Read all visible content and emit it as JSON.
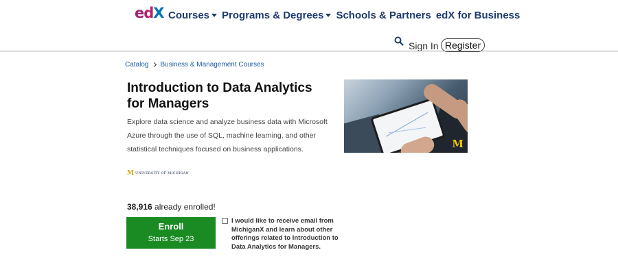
{
  "header": {
    "logo": {
      "e": "e",
      "d": "d",
      "x": "X"
    },
    "nav": [
      {
        "label": "Courses",
        "has_dropdown": true
      },
      {
        "label": "Programs & Degrees",
        "has_dropdown": true
      },
      {
        "label": "Schools & Partners",
        "has_dropdown": false
      },
      {
        "label": "edX for Business",
        "has_dropdown": false
      }
    ],
    "sign_in": "Sign In",
    "register": "Register"
  },
  "breadcrumb": [
    "Catalog",
    "Business & Management Courses"
  ],
  "course": {
    "title": "Introduction to Data Analytics for Managers",
    "description": "Explore data science and analyze business data with Microsoft Azure through the use of SQL, machine learning, and other statistical techniques focused on business applications.",
    "image_badge": "M",
    "university": {
      "mark": "M",
      "name": "UNIVERSITY OF MICHIGAN"
    },
    "enrolled_count": "38,916",
    "enrolled_suffix": " already enrolled!",
    "enroll_label": "Enroll",
    "enroll_sub": "Starts Sep 23",
    "optin_text": "I would like to receive email from MichiganX and learn about other offerings related to Introduction to Data Analytics for Managers.",
    "optin_checked": false
  },
  "colors": {
    "accent": "#1c3a6e",
    "enroll_green": "#1a8a23",
    "link": "#1c5b9e"
  }
}
